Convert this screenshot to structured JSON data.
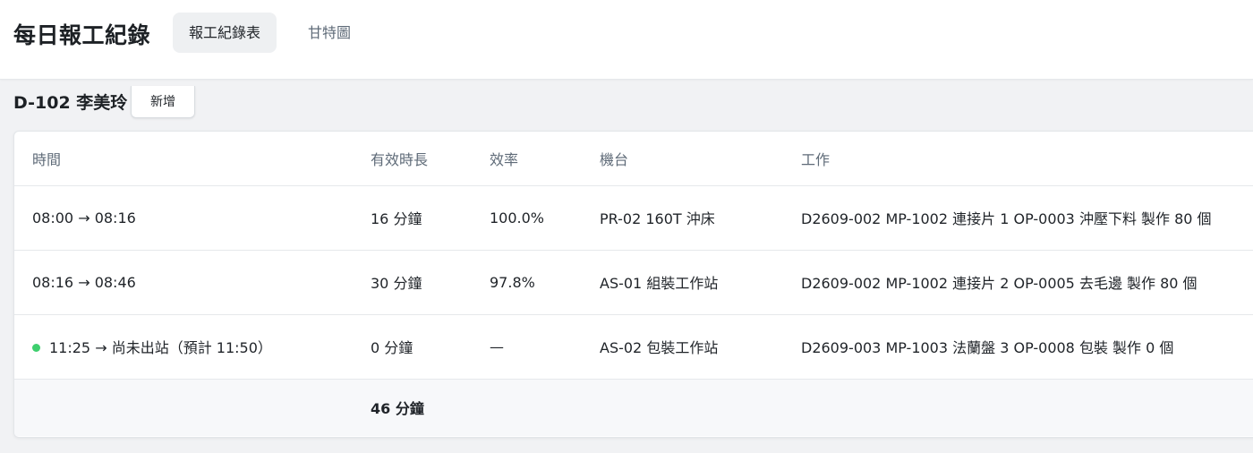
{
  "app": {
    "title": "每日報工紀錄"
  },
  "tabs": [
    {
      "label": "報工紀錄表",
      "active": true
    },
    {
      "label": "甘特圖",
      "active": false
    }
  ],
  "section": {
    "heading": "D-102 李美玲",
    "add_label": "新增"
  },
  "table": {
    "columns": {
      "time": "時間",
      "duration": "有效時長",
      "efficiency": "效率",
      "machine": "機台",
      "work": "工作"
    },
    "rows": [
      {
        "time": "08:00 → 08:16",
        "duration": "16 分鐘",
        "efficiency": "100.0%",
        "machine": "PR-02 160T 沖床",
        "work": "D2609-002 MP-1002 連接片 1 OP-0003 沖壓下料 製作 80 個",
        "live": false
      },
      {
        "time": "08:16 → 08:46",
        "duration": "30 分鐘",
        "efficiency": "97.8%",
        "machine": "AS-01 組裝工作站",
        "work": "D2609-002 MP-1002 連接片 2 OP-0005 去毛邊 製作 80 個",
        "live": false
      },
      {
        "time": "11:25 → 尚未出站（預計 11:50）",
        "duration": "0 分鐘",
        "efficiency": "—",
        "machine": "AS-02 包裝工作站",
        "work": "D2609-003 MP-1003 法蘭盤 3 OP-0008 包裝 製作 0 個",
        "live": true
      }
    ],
    "total_duration": "46 分鐘"
  },
  "colors": {
    "live_indicator": "#3ecf6e",
    "page_background": "#f1f2f4",
    "header_text": "#5f6b78"
  }
}
